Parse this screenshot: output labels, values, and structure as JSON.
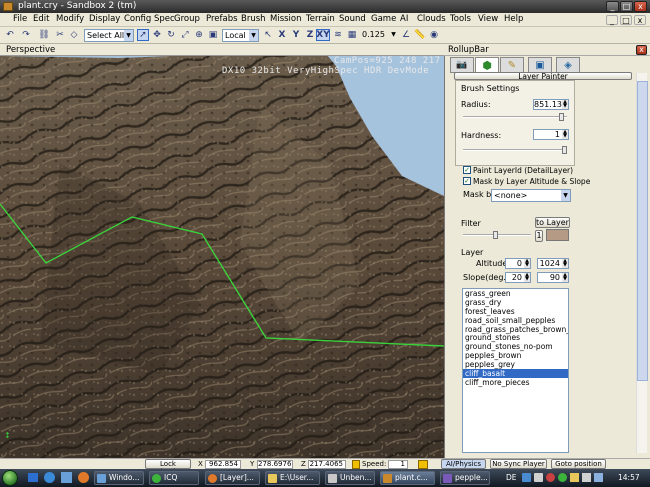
{
  "window": {
    "title": "plant.cry - Sandbox 2 (tm)",
    "minimize": "_",
    "maximize": "□",
    "close": "x"
  },
  "menu": [
    "File",
    "Edit",
    "Modify",
    "Display",
    "Config Spec",
    "Group",
    "Prefabs",
    "Brush",
    "Mission",
    "Terrain",
    "Sound",
    "Game",
    "AI",
    "Clouds",
    "Tools",
    "View",
    "Help"
  ],
  "toolbar": {
    "selection_filter": "Select All",
    "coord_system": "Local",
    "axis_x": "X",
    "axis_y": "Y",
    "axis_z": "Z",
    "axis_xy": "XY",
    "grid_size": "0.125"
  },
  "viewport": {
    "label": "Perspective",
    "campos": "CamPos=925  248  217",
    "renderer": "DX10 32bit VeryHighSpec HDR DevMode"
  },
  "rollup": {
    "title": "RollupBar",
    "panel_title": "Layer Painter",
    "brush_settings_label": "Brush Settings",
    "radius_label": "Radius:",
    "radius_value": "851.13",
    "radius_fraction": 0.97,
    "hardness_label": "Hardness:",
    "hardness_value": "1",
    "hardness_fraction": 1.0,
    "paint_layer_id_label": "Paint LayerId (DetailLayer)",
    "mask_altitude_label": "Mask by Layer Altitude & Slope",
    "mask_by_label": "Mask by",
    "mask_by_value": "<none>",
    "filter_label": "Filter",
    "to_layer_button": "to Layer",
    "filter_button": "1",
    "layer_label": "Layer",
    "altitude_label": "Altitude",
    "altitude_min": "0",
    "altitude_max": "1024",
    "slope_label": "Slope(deg.)",
    "slope_min": "20",
    "slope_max": "90",
    "filter_color": "#b59a86",
    "layers": [
      "grass_green",
      "grass_dry",
      "forest_leaves",
      "road_soil_small_pepples",
      "road_grass_patches_brown_soil",
      "ground_stones",
      "ground_stones_no-pom",
      "pepples_brown",
      "pepples_grey",
      "cliff_basalt",
      "cliff_more_pieces"
    ],
    "selected_layer": "cliff_basalt"
  },
  "statusbar": {
    "lock_selection": "Lock Selection",
    "x_label": "X",
    "x_value": "962.854",
    "y_label": "Y",
    "y_value": "278.6976",
    "z_label": "Z",
    "z_value": "217.4065",
    "speed_label": "Speed:",
    "speed_value": "1",
    "ai_physics": "AI/Physics",
    "no_sync_player": "No Sync Player",
    "goto_position": "Goto position"
  },
  "taskbar": {
    "tasks": [
      "Windo...",
      "ICQ",
      "[Layer]...",
      "E:\\User...",
      "Unben...",
      "plant.c...",
      "pepple..."
    ],
    "active_task": "plant.c...",
    "language": "DE",
    "time": "14:57"
  }
}
